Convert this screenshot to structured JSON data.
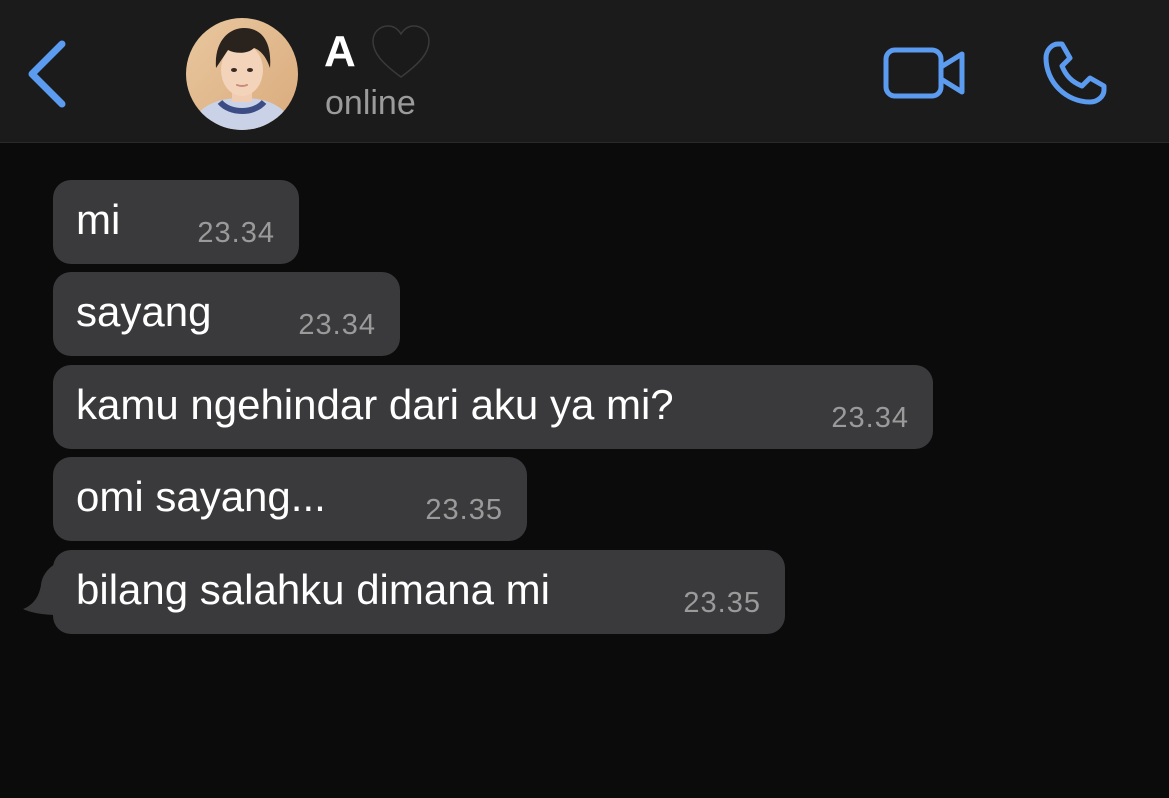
{
  "header": {
    "contact_name": "A",
    "status": "online"
  },
  "icons": {
    "back": "chevron-left-icon",
    "heart": "black-heart-emoji",
    "video": "video-camera-icon",
    "phone": "phone-icon"
  },
  "colors": {
    "accent": "#5b9bf0",
    "header_bg": "#1b1b1b",
    "chat_bg": "#0b0b0b",
    "bubble_bg": "#3a3a3c",
    "timestamp": "#9a9a9a",
    "status_text": "#9b9b9b"
  },
  "messages": [
    {
      "text": "mi",
      "time": "23.34"
    },
    {
      "text": "sayang",
      "time": "23.34"
    },
    {
      "text": "kamu ngehindar dari aku ya mi?",
      "time": "23.34"
    },
    {
      "text": "omi sayang...",
      "time": "23.35"
    },
    {
      "text": "bilang salahku dimana mi",
      "time": "23.35"
    }
  ]
}
